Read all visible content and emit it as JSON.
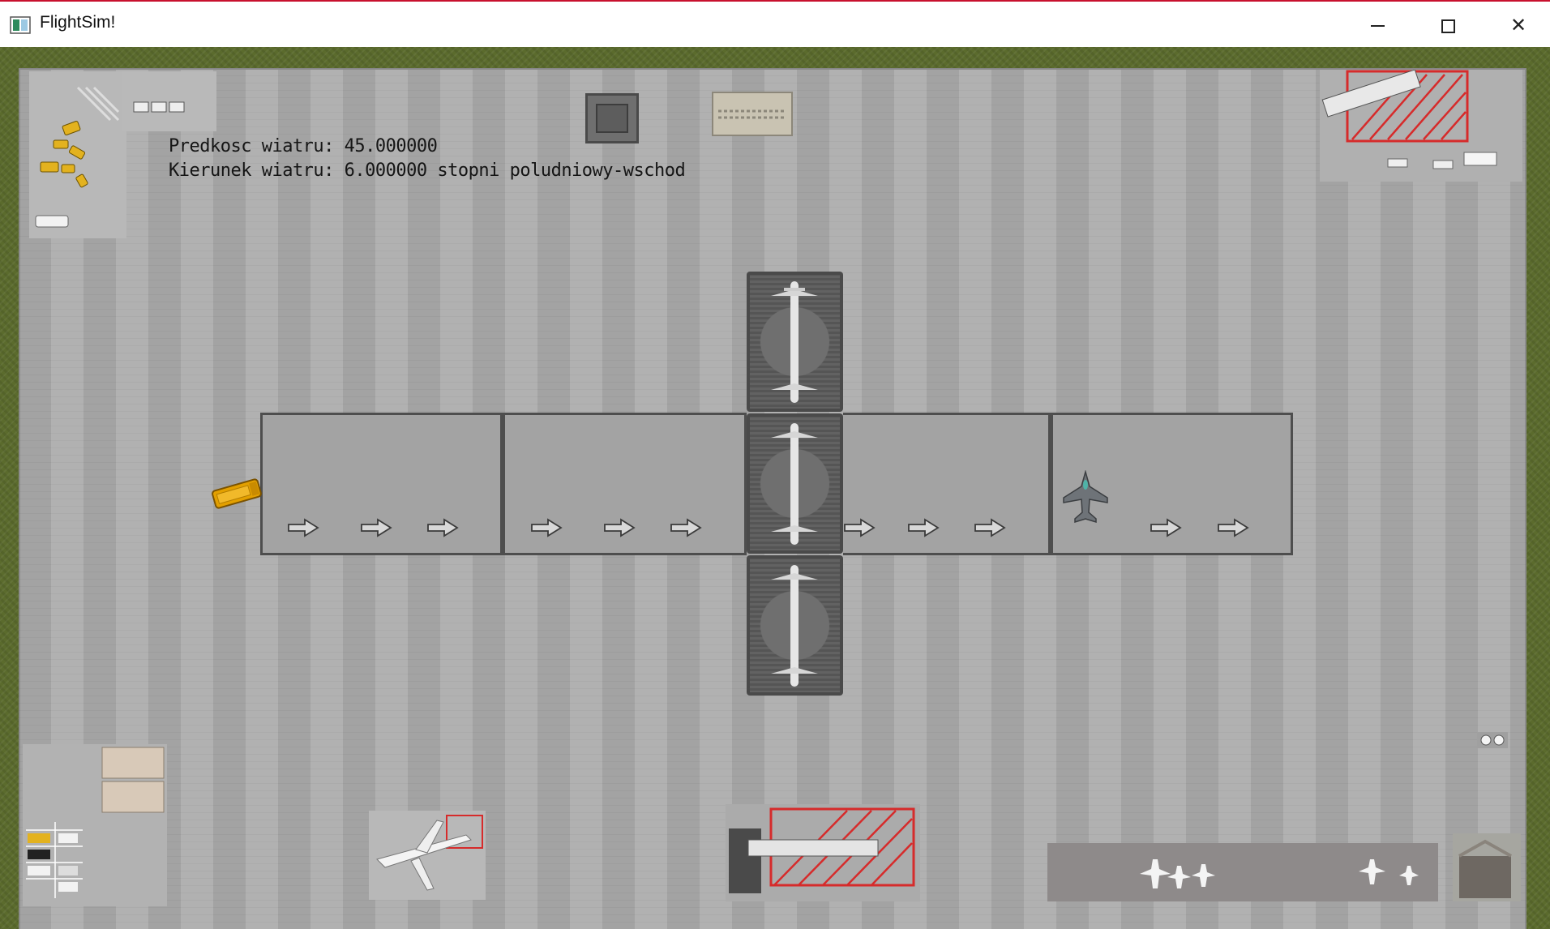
{
  "window": {
    "title": "FlightSim!",
    "minimize_glyph": "",
    "maximize_glyph": "",
    "close_glyph": "✕"
  },
  "hud": {
    "wind_speed": "Predkosc wiatru: 45.000000",
    "wind_direction": "Kierunek wiatru: 6.000000 stopni poludniowy-wschod"
  },
  "runway": {
    "segments": 4,
    "arrows_per_segment": 3,
    "arrow_direction": "right"
  },
  "terminal": {
    "gates": 3
  },
  "entities": {
    "player_plane": "fighter-jet-icon",
    "fuel_truck": "fuel-truck-icon"
  },
  "colors": {
    "apron": "#a9a9a9",
    "runway": "#a3a3a3",
    "runway_border": "#4e4e4e",
    "grass": "#5b6b2d",
    "hazard": "#d62b2b",
    "truck": "#e3a000"
  }
}
